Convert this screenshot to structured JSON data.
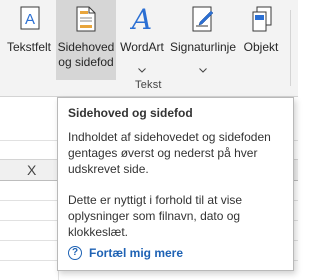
{
  "ribbon": {
    "buttons": [
      {
        "id": "textbox",
        "label_lines": [
          "Tekstfelt"
        ],
        "icon": "textbox-icon"
      },
      {
        "id": "header-footer",
        "label_lines": [
          "Sidehoved",
          "og sidefod"
        ],
        "icon": "header-footer-icon",
        "selected": true
      },
      {
        "id": "wordart",
        "label_lines": [
          "WordArt"
        ],
        "icon": "wordart-icon",
        "has_dropdown": true
      },
      {
        "id": "signature-line",
        "label_lines": [
          "Signaturlinje"
        ],
        "icon": "signature-line-icon",
        "has_dropdown": true
      },
      {
        "id": "object",
        "label_lines": [
          "Objekt"
        ],
        "icon": "object-icon"
      }
    ],
    "group_label": "Tekst"
  },
  "sheet": {
    "column_header": "X"
  },
  "tooltip": {
    "title": "Sidehoved og sidefod",
    "paragraph1": "Indholdet af sidehovedet og sidefoden gentages øverst og nederst på hver udskrevet side.",
    "paragraph2": "Dette er nyttigt i forhold til at vise oplysninger som filnavn, dato og klokkeslæt.",
    "link_label": "Fortæl mig mere",
    "link_icon": "help-circle-icon"
  },
  "colors": {
    "accent": "#1e62b4",
    "wordart_blue": "#2b6fd3",
    "selected_bg": "#d6d6d6",
    "ribbon_bg": "#f3f3f3"
  }
}
